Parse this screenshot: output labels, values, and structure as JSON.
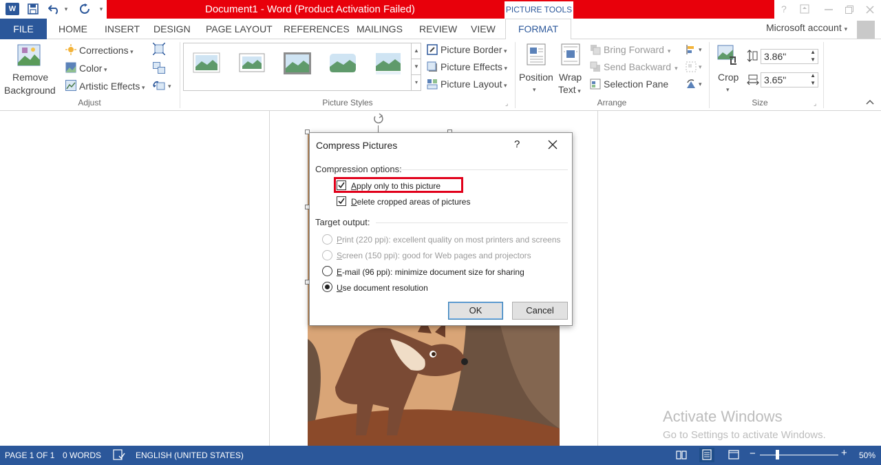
{
  "window": {
    "title": "Document1 -  Word (Product Activation Failed)",
    "context_tab_group": "PICTURE TOOLS",
    "help": "?",
    "account": "Microsoft account"
  },
  "tabs": [
    "FILE",
    "HOME",
    "INSERT",
    "DESIGN",
    "PAGE LAYOUT",
    "REFERENCES",
    "MAILINGS",
    "REVIEW",
    "VIEW",
    "FORMAT"
  ],
  "ribbon": {
    "adjust": {
      "remove_background_line1": "Remove",
      "remove_background_line2": "Background",
      "corrections": "Corrections",
      "color": "Color",
      "artistic_effects": "Artistic Effects",
      "group": "Adjust"
    },
    "picture_styles": {
      "picture_border": "Picture Border",
      "picture_effects": "Picture Effects",
      "picture_layout": "Picture Layout",
      "group": "Picture Styles"
    },
    "arrange": {
      "position": "Position",
      "wrap_text_line1": "Wrap",
      "wrap_text_line2": "Text",
      "bring_forward": "Bring Forward",
      "send_backward": "Send Backward",
      "selection_pane": "Selection Pane",
      "group": "Arrange"
    },
    "size": {
      "crop": "Crop",
      "height": "3.86\"",
      "width": "3.65\"",
      "group": "Size"
    }
  },
  "dialog": {
    "title": "Compress Pictures",
    "help": "?",
    "compression_label": "Compression options:",
    "apply_only": "Apply only to this picture",
    "apply_only_checked": true,
    "delete_cropped": "Delete cropped areas of pictures",
    "delete_cropped_checked": true,
    "target_label": "Target output:",
    "options": [
      {
        "label": "Print (220 ppi): excellent quality on most printers and screens",
        "enabled": false,
        "selected": false
      },
      {
        "label": "Screen (150 ppi): good for Web pages and projectors",
        "enabled": false,
        "selected": false
      },
      {
        "label": "E-mail (96 ppi): minimize document size for sharing",
        "enabled": true,
        "selected": false
      },
      {
        "label": "Use document resolution",
        "enabled": true,
        "selected": true
      }
    ],
    "ok": "OK",
    "cancel": "Cancel"
  },
  "watermark": {
    "line1": "Activate Windows",
    "line2": "Go to Settings to activate Windows."
  },
  "status": {
    "page": "PAGE 1 OF 1",
    "words": "0 WORDS",
    "language": "ENGLISH (UNITED STATES)",
    "zoom": "50%",
    "zoom_minus": "−",
    "zoom_plus": "+"
  },
  "colors": {
    "word_blue": "#2b579a",
    "title_red": "#e8000b",
    "highlight": "#e1001a"
  }
}
